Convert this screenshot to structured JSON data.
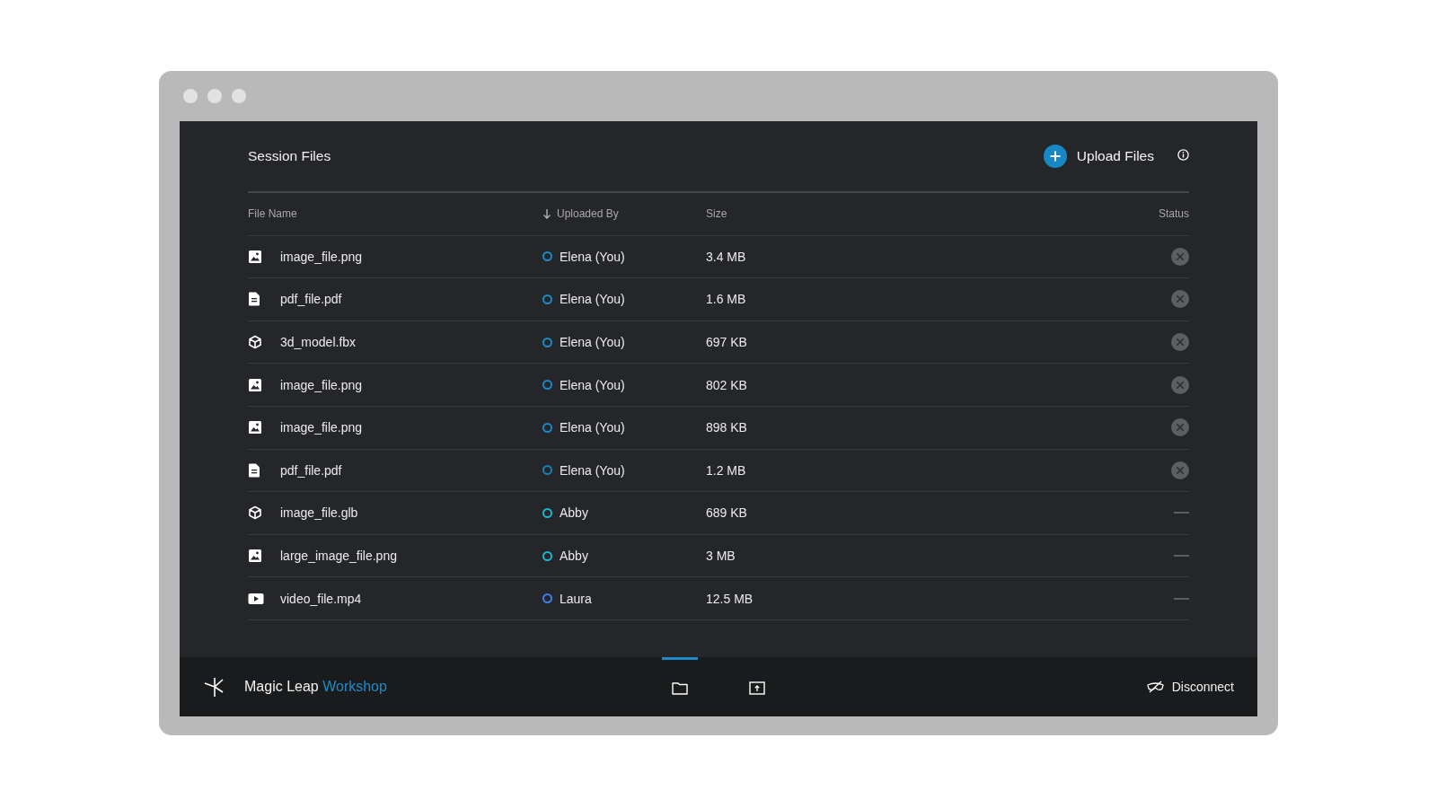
{
  "title": "Session Files",
  "upload_button": "Upload Files",
  "table": {
    "columns": [
      {
        "label": "File Name",
        "sorted": false
      },
      {
        "label": "Uploaded By",
        "sorted": true
      },
      {
        "label": "Size",
        "sorted": false
      },
      {
        "label": "Status",
        "sorted": false
      }
    ],
    "rows": [
      {
        "kind": "image",
        "name": "image_file.png",
        "uploader": "Elena (You)",
        "color": "#1a8ac7",
        "size": "3.4 MB",
        "status": {
          "kind": "cancel"
        }
      },
      {
        "kind": "document",
        "name": "pdf_file.pdf",
        "uploader": "Elena (You)",
        "color": "#1a8ac7",
        "size": "1.6 MB",
        "status": {
          "kind": "cancel"
        }
      },
      {
        "kind": "model",
        "name": "3d_model.fbx",
        "uploader": "Elena (You)",
        "color": "#1a8ac7",
        "size": "697 KB",
        "status": {
          "kind": "cancel"
        }
      },
      {
        "kind": "image",
        "name": "image_file.png",
        "uploader": "Elena (You)",
        "color": "#1a8ac7",
        "size": "802 KB",
        "status": {
          "kind": "cancel"
        }
      },
      {
        "kind": "image",
        "name": "image_file.png",
        "uploader": "Elena (You)",
        "color": "#1a8ac7",
        "size": "898 KB",
        "status": {
          "kind": "cancel"
        }
      },
      {
        "kind": "document",
        "name": "pdf_file.pdf",
        "uploader": "Elena (You)",
        "color": "#1780b5",
        "size": "1.2 MB",
        "status": {
          "kind": "cancel"
        }
      },
      {
        "kind": "model",
        "name": "image_file.glb",
        "uploader": "Abby",
        "color": "#1ab7cf",
        "size": "689 KB",
        "status": {
          "kind": "pending"
        }
      },
      {
        "kind": "image",
        "name": "large_image_file.png",
        "uploader": "Abby",
        "color": "#1ab7cf",
        "size": "3 MB",
        "status": {
          "kind": "pending"
        }
      },
      {
        "kind": "video",
        "name": "video_file.mp4",
        "uploader": "Laura",
        "color": "#3a80ee",
        "size": "12.5 MB",
        "status": {
          "kind": "pending"
        }
      }
    ]
  },
  "footer": {
    "brand": "Magic Leap",
    "brand_accent": "Workshop",
    "nav": [
      {
        "kind": "folder",
        "selected": true
      },
      {
        "kind": "upload",
        "selected": false
      }
    ],
    "disconnect": "Disconnect"
  }
}
